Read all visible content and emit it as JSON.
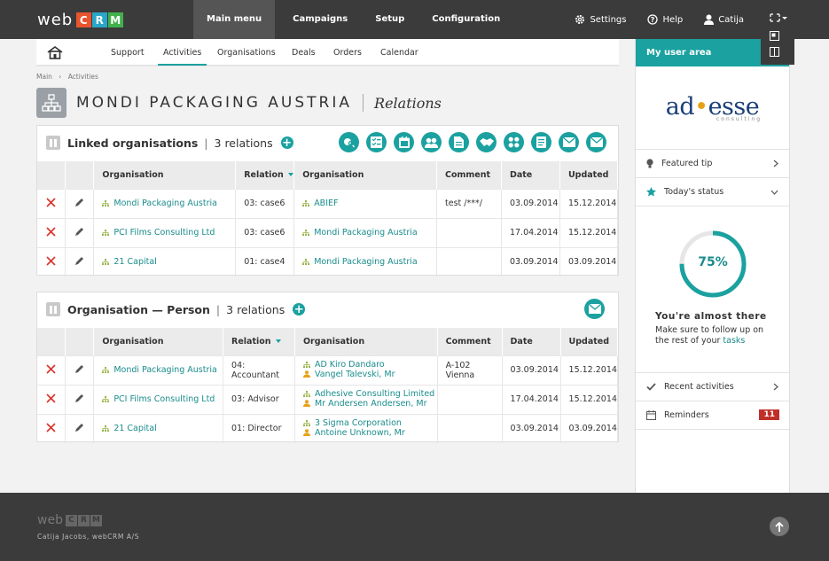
{
  "topbar": {
    "logo_text": "web",
    "logo_letters": [
      {
        "ch": "C",
        "color": "#e8542d"
      },
      {
        "ch": "R",
        "color": "#29a7c9"
      },
      {
        "ch": "M",
        "color": "#42b14c"
      }
    ],
    "nav": [
      "Main menu",
      "Campaigns",
      "Setup",
      "Configuration"
    ],
    "settings": "Settings",
    "help": "Help",
    "user": "Catija"
  },
  "subnav": [
    "Support",
    "Activities",
    "Organisations",
    "Deals",
    "Orders",
    "Calendar"
  ],
  "breadcrumb": [
    "Main",
    "Activities"
  ],
  "header": {
    "title": "MONDI PACKAGING AUSTRIA",
    "subtitle": "Relations"
  },
  "linked": {
    "title": "Linked organisations",
    "count": "3 relations",
    "columns": [
      "Organisation",
      "Relation",
      "Organisation",
      "Comment",
      "Date",
      "Updated"
    ],
    "rows": [
      {
        "org1": "Mondi Packaging Austria",
        "relation": "03: case6",
        "org2": "ABIEF",
        "comment": "test /***/",
        "date": "03.09.2014",
        "updated": "15.12.2014"
      },
      {
        "org1": "PCI Films Consulting Ltd",
        "relation": "03: case6",
        "org2": "Mondi Packaging Austria",
        "comment": "",
        "date": "17.04.2014",
        "updated": "15.12.2014"
      },
      {
        "org1": "21 Capital",
        "relation": "01: case4",
        "org2": "Mondi Packaging Austria",
        "comment": "",
        "date": "03.09.2014",
        "updated": "03.09.2014"
      }
    ]
  },
  "orgperson": {
    "title": "Organisation — Person",
    "count": "3 relations",
    "columns": [
      "Organisation",
      "Relation",
      "Organisation",
      "Comment",
      "Date",
      "Updated"
    ],
    "rows": [
      {
        "org1": "Mondi Packaging Austria",
        "relation": "04: Accountant",
        "org2": "AD Kiro Dandaro",
        "person": "Vangel Talevski, Mr",
        "comment": "A-102 Vienna",
        "date": "03.09.2014",
        "updated": "15.12.2014"
      },
      {
        "org1": "PCI Films Consulting Ltd",
        "relation": "03: Advisor",
        "org2": "Adhesive Consulting Limited",
        "person": "Mr Andersen Andersen, Mr",
        "comment": "",
        "date": "17.04.2014",
        "updated": "15.12.2014"
      },
      {
        "org1": "21 Capital",
        "relation": "01: Director",
        "org2": "3 Sigma Corporation",
        "person": "Antoine Unknown, Mr",
        "comment": "",
        "date": "03.09.2014",
        "updated": "03.09.2014"
      }
    ]
  },
  "sidebar": {
    "title": "My user area",
    "logo_main": "ad",
    "logo_dot": "•",
    "logo_rest": "esse",
    "logo_sub": "consulting",
    "featured": "Featured tip",
    "status": "Today's status",
    "progress_pct": 75,
    "progress_label": "75%",
    "almost": "You're almost there",
    "follow_text": "Make sure to follow up on the rest of your",
    "tasks_link": "tasks",
    "recent": "Recent activities",
    "reminders": "Reminders",
    "reminders_count": "11"
  },
  "footer": {
    "logo_text": "web",
    "logo_letters": [
      "C",
      "R",
      "M"
    ],
    "copy": "Catija Jacobs,  webCRM A/S"
  },
  "colors": {
    "accent": "#1aa1a0",
    "delete": "#d9342b",
    "topbar": "#3b3b3b"
  }
}
